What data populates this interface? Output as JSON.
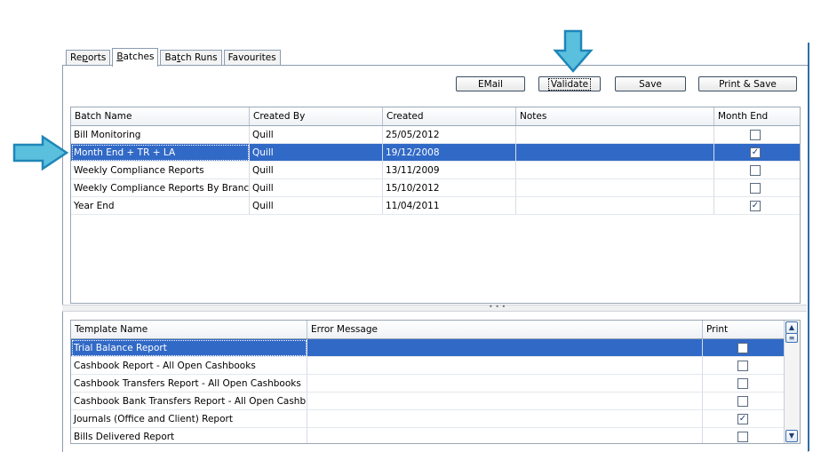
{
  "tabs": [
    {
      "label": "Reports",
      "pre": "Re",
      "u": "p",
      "post": "orts",
      "active": false
    },
    {
      "label": "Batches",
      "pre": "",
      "u": "B",
      "post": "atches",
      "active": true
    },
    {
      "label": "Batch Runs",
      "pre": "Ba",
      "u": "t",
      "post": "ch Runs",
      "active": false
    },
    {
      "label": "Favourites",
      "pre": "",
      "u": "",
      "post": "Favourites",
      "active": false
    }
  ],
  "toolbar": {
    "email_label": "EMail",
    "validate_label": "Validate",
    "save_label": "Save",
    "print_save_label": "Print & Save"
  },
  "batches": {
    "columns": [
      "Batch Name",
      "Created By",
      "Created",
      "Notes",
      "Month End"
    ],
    "rows": [
      {
        "name": "Bill Monitoring",
        "created_by": "Quill",
        "created": "25/05/2012",
        "notes": "",
        "month_end": false
      },
      {
        "name": "Month End + TR + LA",
        "created_by": "Quill",
        "created": "19/12/2008",
        "notes": "",
        "month_end": true
      },
      {
        "name": "Weekly Compliance Reports",
        "created_by": "Quill",
        "created": "13/11/2009",
        "notes": "",
        "month_end": false
      },
      {
        "name": "Weekly Compliance Reports By Branch",
        "created_by": "Quill",
        "created": "15/10/2012",
        "notes": "",
        "month_end": false
      },
      {
        "name": "Year End",
        "created_by": "Quill",
        "created": "11/04/2011",
        "notes": "",
        "month_end": true
      }
    ]
  },
  "templates": {
    "columns": [
      "Template Name",
      "Error Message",
      "Print"
    ],
    "rows": [
      {
        "name": "Trial Balance Report",
        "error": "",
        "print": false
      },
      {
        "name": "Cashbook Report  - All Open Cashbooks",
        "error": "",
        "print": false
      },
      {
        "name": "Cashbook Transfers Report  - All Open Cashbooks",
        "error": "",
        "print": false
      },
      {
        "name": "Cashbook Bank Transfers Report  - All Open Cashb…",
        "error": "",
        "print": false
      },
      {
        "name": "Journals (Office and Client) Report",
        "error": "",
        "print": true
      },
      {
        "name": "Bills Delivered Report",
        "error": "",
        "print": false
      }
    ]
  },
  "colors": {
    "selection": "#3169c6",
    "arrow": "#5bc0de",
    "arrow_border": "#1f86b8"
  }
}
